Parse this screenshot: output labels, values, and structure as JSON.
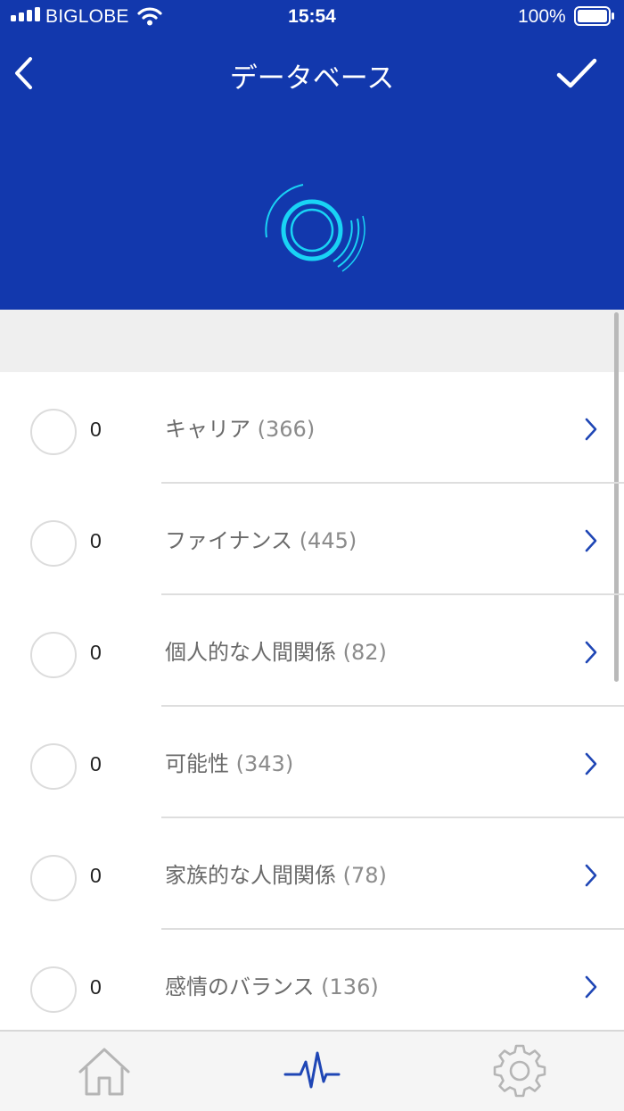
{
  "status_bar": {
    "carrier": "BIGLOBE",
    "time": "15:54",
    "battery_percent": "100%"
  },
  "nav": {
    "title": "データベース",
    "back_icon": "chevron-left-icon",
    "done_icon": "checkmark-icon"
  },
  "colors": {
    "header_bg": "#1238ad",
    "accent": "#1238ad",
    "logo": "#19d3f5"
  },
  "list": {
    "items": [
      {
        "count": "0",
        "name": "キャリア",
        "total": "(366)"
      },
      {
        "count": "0",
        "name": "ファイナンス",
        "total": "(445)"
      },
      {
        "count": "0",
        "name": "個人的な人間関係",
        "total": "(82)"
      },
      {
        "count": "0",
        "name": "可能性",
        "total": "(343)"
      },
      {
        "count": "0",
        "name": "家族的な人間関係",
        "total": "(78)"
      },
      {
        "count": "0",
        "name": "感情のバランス",
        "total": "(136)"
      }
    ]
  },
  "tabbar": {
    "tabs": [
      {
        "icon": "home-icon",
        "selected": false
      },
      {
        "icon": "pulse-icon",
        "selected": true
      },
      {
        "icon": "gear-icon",
        "selected": false
      }
    ]
  }
}
